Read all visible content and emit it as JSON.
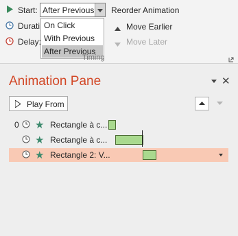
{
  "ribbon": {
    "start_label": "Start:",
    "start_value": "After Previous",
    "duration_label": "Durati",
    "delay_label": "Delay:",
    "reorder_title": "Reorder Animation",
    "move_earlier": "Move Earlier",
    "move_later": "Move Later",
    "group_label": "Timing"
  },
  "start_options": [
    "On Click",
    "With Previous",
    "After Previous"
  ],
  "selected_option": "After Previous",
  "pane": {
    "title": "Animation Pane",
    "play_from": "Play From",
    "rows": [
      {
        "number": "0",
        "name": "Rectangle à c...",
        "selected": false
      },
      {
        "number": "",
        "name": "Rectangle à c...",
        "selected": false
      },
      {
        "number": "",
        "name": "Rectangle 2: V...",
        "selected": true
      }
    ]
  },
  "colors": {
    "title": "#d24726",
    "selected_row": "#f9c9b4",
    "timeline_bar": "#a9d98e",
    "star": "#3d8a6d"
  }
}
